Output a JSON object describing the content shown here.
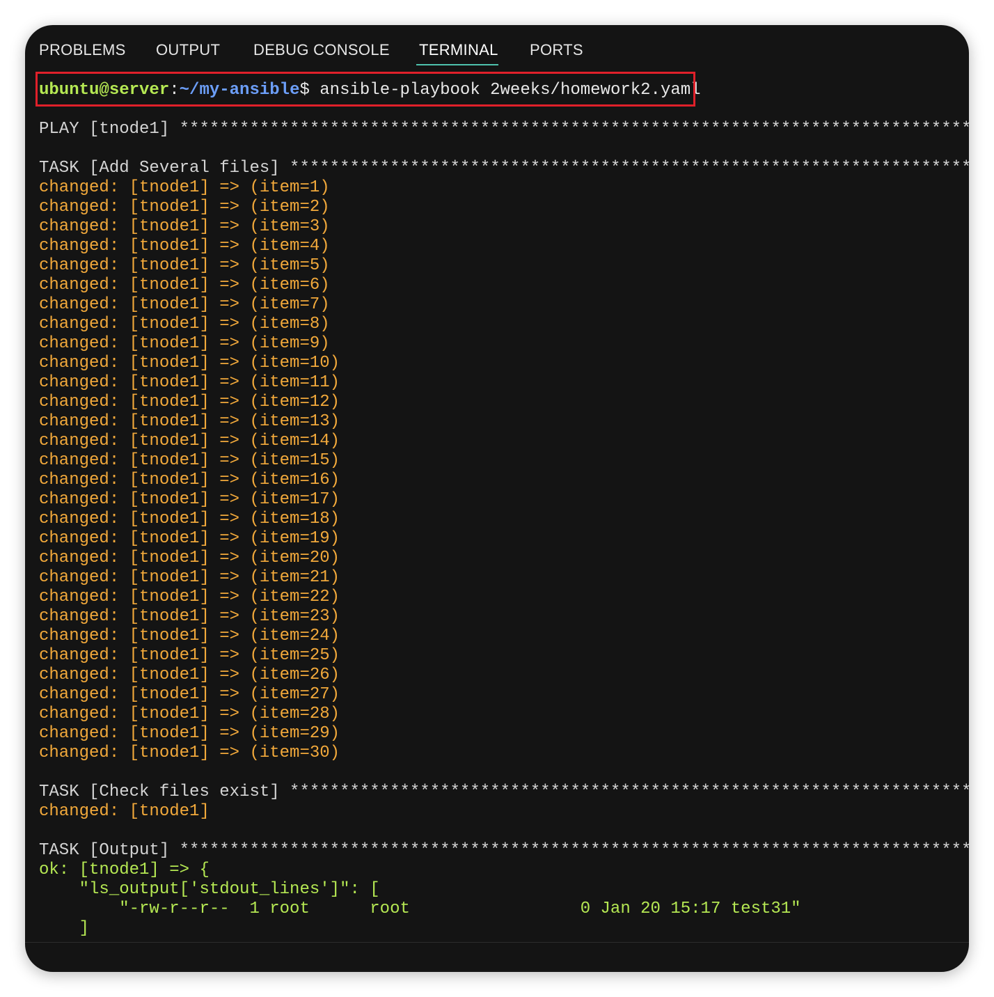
{
  "tabs": [
    {
      "label": "PROBLEMS"
    },
    {
      "label": "OUTPUT"
    },
    {
      "label": "DEBUG CONSOLE"
    },
    {
      "label": "TERMINAL",
      "active": true
    },
    {
      "label": "PORTS"
    }
  ],
  "prompt": {
    "user_host": "ubuntu@server",
    "colon": ":",
    "path": "~/my-ansible",
    "dollar": "$ ",
    "command": "ansible-playbook 2weeks/homework2.yaml"
  },
  "output": {
    "play_header": "PLAY [tnode1] ********************************************************************************************************",
    "task_add_header": "TASK [Add Several files] *********************************************************************************************",
    "changed_lines": [
      "changed: [tnode1] => (item=1)",
      "changed: [tnode1] => (item=2)",
      "changed: [tnode1] => (item=3)",
      "changed: [tnode1] => (item=4)",
      "changed: [tnode1] => (item=5)",
      "changed: [tnode1] => (item=6)",
      "changed: [tnode1] => (item=7)",
      "changed: [tnode1] => (item=8)",
      "changed: [tnode1] => (item=9)",
      "changed: [tnode1] => (item=10)",
      "changed: [tnode1] => (item=11)",
      "changed: [tnode1] => (item=12)",
      "changed: [tnode1] => (item=13)",
      "changed: [tnode1] => (item=14)",
      "changed: [tnode1] => (item=15)",
      "changed: [tnode1] => (item=16)",
      "changed: [tnode1] => (item=17)",
      "changed: [tnode1] => (item=18)",
      "changed: [tnode1] => (item=19)",
      "changed: [tnode1] => (item=20)",
      "changed: [tnode1] => (item=21)",
      "changed: [tnode1] => (item=22)",
      "changed: [tnode1] => (item=23)",
      "changed: [tnode1] => (item=24)",
      "changed: [tnode1] => (item=25)",
      "changed: [tnode1] => (item=26)",
      "changed: [tnode1] => (item=27)",
      "changed: [tnode1] => (item=28)",
      "changed: [tnode1] => (item=29)",
      "changed: [tnode1] => (item=30)"
    ],
    "task_check_header": "TASK [Check files exist] *********************************************************************************************",
    "check_result": "changed: [tnode1]",
    "task_output_header": "TASK [Output] ********************************************************************************************************",
    "ok_lines": [
      "ok: [tnode1] => {",
      "    \"ls_output['stdout_lines']\": [",
      "        \"-rw-r--r--  1 root      root                 0 Jan 20 15:17 test31\"",
      "    ]"
    ]
  },
  "colors": {
    "background": "#141414",
    "prompt_user": "#b5e853",
    "prompt_path": "#6c9ef8",
    "changed": "#f2a93b",
    "ok": "#b5e853",
    "highlight_border": "#e0202a",
    "tab_active_underline": "#4ec2ad"
  }
}
